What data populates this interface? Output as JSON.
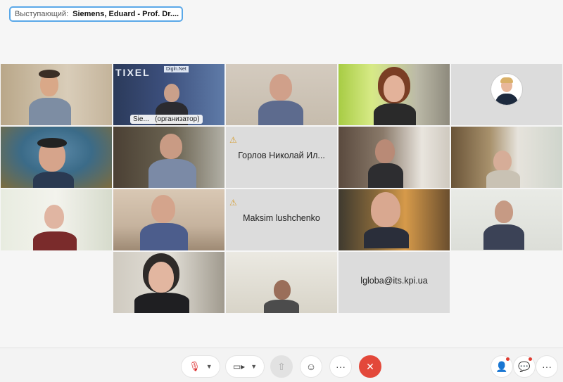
{
  "speaker": {
    "label": "Выступающий:",
    "name": "Siemens, Eduard - Prof. Dr...."
  },
  "tiles": {
    "t2_label_name": "Sie...",
    "t2_label_role": "(организатор)",
    "t2_logo": "TIXEL",
    "t2_banner": "Digln.Net",
    "t8_name": "Горлов Николай Ил...",
    "t13_name": "Maksim lushchenko",
    "t19_name": "lgloba@its.kpi.ua"
  },
  "toolbar": {
    "mic_icon": "mic-muted-icon",
    "video_icon": "video-camera-icon",
    "share_icon": "share-screen-icon",
    "reactions_icon": "smile-icon",
    "more_label": "···",
    "end_label": "✕",
    "participants_icon": "participants-icon",
    "chat_icon": "chat-icon",
    "overflow_label": "···"
  },
  "colors": {
    "accent": "#3fa7e6",
    "end_call": "#e3483a",
    "warning": "#d6a13a"
  }
}
